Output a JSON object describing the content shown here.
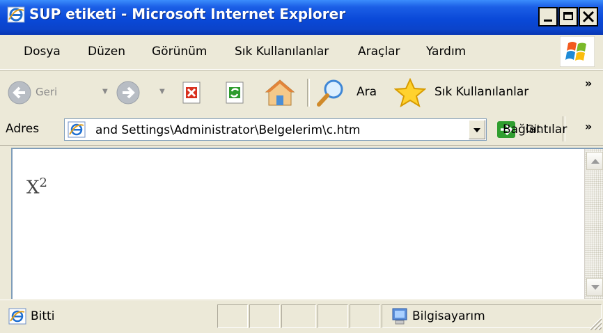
{
  "window": {
    "title": "SUP etiketi - Microsoft Internet Explorer",
    "title_icon": "ie-icon",
    "controls": [
      "minimize",
      "maximize",
      "close"
    ]
  },
  "menu": {
    "items": [
      "Dosya",
      "Düzen",
      "Görünüm",
      "Sık Kullanılanlar",
      "Araçlar",
      "Yardım"
    ]
  },
  "toolbar": {
    "back_label": "Geri",
    "search_label": "Ara",
    "favorites_label": "Sık Kullanılanlar",
    "more_glyph": "»"
  },
  "address": {
    "label": "Adres",
    "value": "and Settings\\Administrator\\Belgelerim\\c.htm",
    "go_label": "Git",
    "links_label": "Bağlantılar",
    "more_glyph": "»"
  },
  "content": {
    "base": "X",
    "superscript": "2"
  },
  "status": {
    "text": "Bitti",
    "zone": "Bilgisayarım"
  },
  "colors": {
    "titlebar": "#0a49d8",
    "chrome": "#ece9d8",
    "border": "#7f9db9"
  }
}
